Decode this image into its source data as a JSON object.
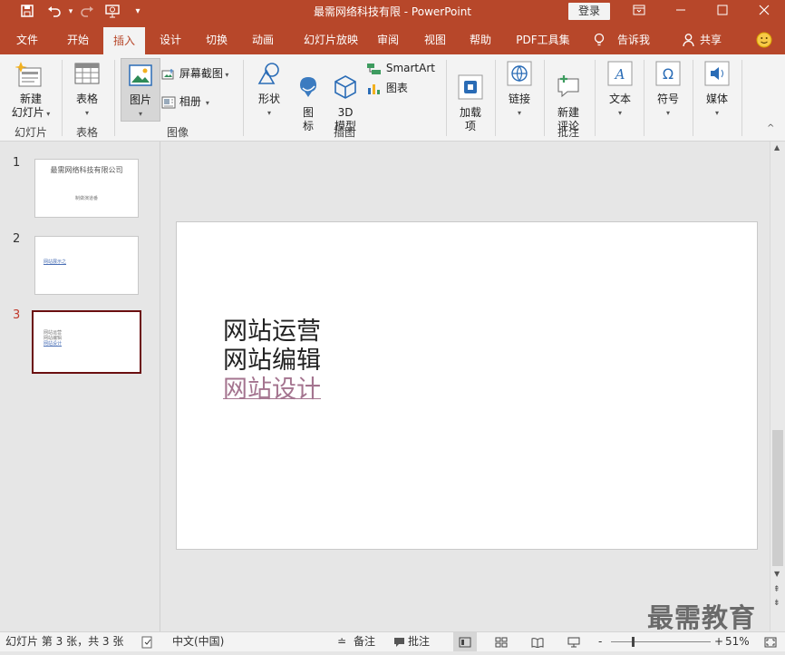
{
  "titlebar": {
    "title": "最需网络科技有限 - PowerPoint",
    "login_label": "登录",
    "quick_access": [
      "save-icon",
      "undo-icon",
      "redo-icon",
      "start-presentation-icon",
      "customize-icon"
    ]
  },
  "tabs": [
    "文件",
    "开始",
    "插入",
    "设计",
    "切换",
    "动画",
    "幻灯片放映",
    "审阅",
    "视图",
    "帮助",
    "PDF工具集",
    "告诉我",
    "共享"
  ],
  "ribbon": {
    "slides_group": {
      "new_slide": "新建\n幻灯片",
      "label": "幻灯片"
    },
    "tables_group": {
      "table": "表格",
      "label": "表格"
    },
    "images_group": {
      "picture": "图片",
      "screenshot": "屏幕截图",
      "album": "相册",
      "label": "图像"
    },
    "illustrations_group": {
      "shapes": "形状",
      "icons": "图\n标",
      "model3d": "3D\n模型",
      "smartart": "SmartArt",
      "chart": "图表",
      "label": "插图"
    },
    "addins": {
      "label": "加载\n项"
    },
    "links": {
      "label": "链接"
    },
    "comments_group": {
      "new_comment": "新建\n评论",
      "label": "批注"
    },
    "text": {
      "label": "文本"
    },
    "symbols": {
      "label": "符号"
    },
    "media": {
      "label": "媒体"
    }
  },
  "slides": [
    {
      "num": "1",
      "title": "最需网络科技有限公司",
      "subtitle": "制做演道番"
    },
    {
      "num": "2",
      "link": "网站展示之"
    },
    {
      "num": "3",
      "lines": [
        "网站运营",
        "网站编辑",
        "网站设计"
      ]
    }
  ],
  "current_slide": {
    "lines": [
      "网站运营",
      "网站编辑",
      "网站设计"
    ]
  },
  "status": {
    "slide_info": "幻灯片 第 3 张，共 3 张",
    "language": "中文(中国)",
    "notes": "备注",
    "comments": "批注",
    "zoom": "51%"
  },
  "watermark": "最需教育",
  "colors": {
    "accent": "#b7472a",
    "link": "#a4748f",
    "selected_border": "#6b0f10"
  }
}
